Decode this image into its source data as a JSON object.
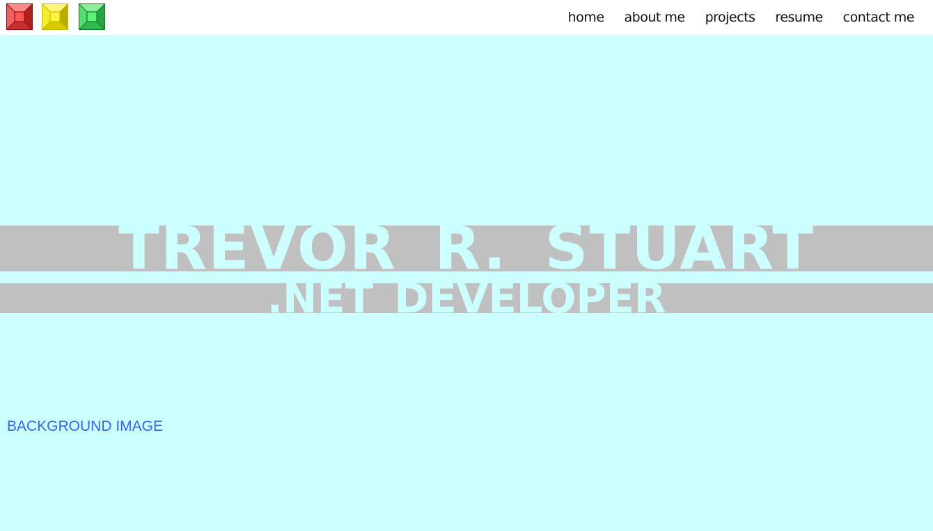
{
  "window_buttons": [
    {
      "name": "red",
      "color": "#e84646",
      "dark": "#8b0d0d",
      "light": "#ff8a8a"
    },
    {
      "name": "yellow",
      "color": "#f2e600",
      "dark": "#a39800",
      "light": "#fff77a"
    },
    {
      "name": "green",
      "color": "#3ecf5a",
      "dark": "#0b7a22",
      "light": "#8af09e"
    }
  ],
  "nav": {
    "items": [
      {
        "label": "home"
      },
      {
        "label": "about me"
      },
      {
        "label": "projects"
      },
      {
        "label": "resume"
      },
      {
        "label": "contact me"
      }
    ]
  },
  "hero": {
    "name": "TREVOR R. STUART",
    "role": ".NET DEVELOPER"
  },
  "background_label": "BACKGROUND IMAGE",
  "colors": {
    "page_bg": "#ccffff",
    "topbar_bg": "#ffffff",
    "band": "#c0c0c0",
    "hero_text": "#ccffff",
    "label_text": "#3366ff"
  }
}
